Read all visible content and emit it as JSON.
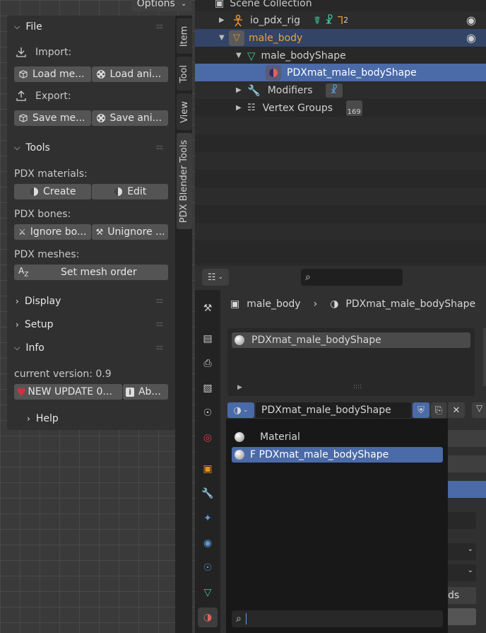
{
  "viewport": {
    "options_label": "Options",
    "tabs": [
      "Item",
      "Tool",
      "View",
      "PDX Blender Tools"
    ]
  },
  "npanel": {
    "file": {
      "title": "File",
      "import_label": "Import:",
      "import_buttons": [
        "Load me...",
        "Load ani..."
      ],
      "export_label": "Export:",
      "export_buttons": [
        "Save me...",
        "Save ani..."
      ]
    },
    "tools": {
      "title": "Tools",
      "materials_label": "PDX materials:",
      "materials_buttons": [
        "Create",
        "Edit"
      ],
      "bones_label": "PDX bones:",
      "bones_buttons": [
        "Ignore bo...",
        "Unignore ..."
      ],
      "meshes_label": "PDX meshes:",
      "mesh_order_button": "Set mesh order"
    },
    "display_title": "Display",
    "setup_title": "Setup",
    "info": {
      "title": "Info",
      "version": "current version: 0.9",
      "update_button": "NEW UPDATE 0...",
      "about_button": "Ab..."
    },
    "help_title": "Help"
  },
  "outliner": {
    "root": "Scene Collection",
    "rows": [
      {
        "label": "io_pdx_rig",
        "badge": "2"
      },
      {
        "label": "male_body"
      },
      {
        "label": "male_bodyShape"
      },
      {
        "label": "PDXmat_male_bodyShape"
      },
      {
        "label": "Modifiers"
      },
      {
        "label": "Vertex Groups",
        "badge": "169"
      }
    ]
  },
  "properties": {
    "breadcrumb": [
      "male_body",
      "PDXmat_male_bodyShape"
    ],
    "slots": [
      "PDXmat_male_bodyShape"
    ],
    "material_field": "PDXmat_male_bodyShape",
    "dropdown_items": [
      "Material",
      "F PDXmat_male_bodyShape"
    ],
    "partial_text": "ds"
  },
  "colors": {
    "selection": "#4a6aa8",
    "orange": "#e8902a",
    "teal": "#3ec8a0",
    "update_heart": "#d03040"
  }
}
